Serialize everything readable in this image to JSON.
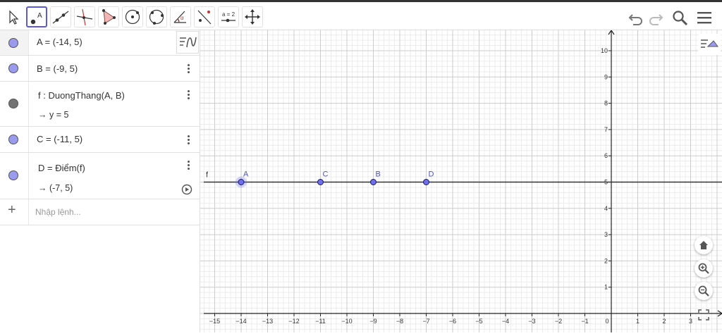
{
  "toolbar": {
    "tools": [
      {
        "name": "move-tool",
        "label": "Move"
      },
      {
        "name": "point-tool",
        "label": "A",
        "active": true
      },
      {
        "name": "line-tool",
        "label": "Line"
      },
      {
        "name": "perpendicular-line-tool",
        "label": "Perpendicular"
      },
      {
        "name": "polygon-tool",
        "label": "Polygon"
      },
      {
        "name": "circle-tool",
        "label": "Circle"
      },
      {
        "name": "circle-three-points-tool",
        "label": "Circle 3 points"
      },
      {
        "name": "angle-tool",
        "label": "Angle"
      },
      {
        "name": "reflect-tool",
        "label": "Reflect"
      },
      {
        "name": "slider-tool",
        "label": "a = 2"
      },
      {
        "name": "move-graphics-view-tool",
        "label": "Move view"
      }
    ],
    "slider_label": "a = 2",
    "point_label": "A",
    "angle_label": "α",
    "right_icons": [
      "undo-icon",
      "redo-icon",
      "search-icon",
      "menu-icon"
    ]
  },
  "algebra": {
    "rows": [
      {
        "text": "A = (-14, 5)",
        "color": "#9a9aee"
      },
      {
        "text": "B = (-9, 5)",
        "color": "#9a9aee"
      },
      {
        "text": "f : DuongThang(A, B)",
        "sub": "→  y = 5",
        "color": "#737373"
      },
      {
        "text": "C = (-11, 5)",
        "color": "#9a9aee"
      },
      {
        "text": "D  =  Điểm(f)",
        "sub": "→  (-7, 5)",
        "color": "#9a9aee"
      }
    ],
    "input_placeholder": "Nhập lệnh...",
    "plus": "+"
  },
  "graphics": {
    "x_ticks": [
      "−15",
      "−14",
      "−13",
      "−12",
      "−11",
      "−10",
      "−9",
      "−8",
      "−7",
      "−6",
      "−5",
      "−4",
      "−3",
      "−2",
      "−1",
      "0",
      "1",
      "2",
      "3"
    ],
    "y_ticks": [
      "1",
      "2",
      "3",
      "4",
      "5",
      "6",
      "7",
      "8",
      "9",
      "10"
    ],
    "line_label": "f",
    "line_y": 5,
    "points": [
      {
        "label": "A",
        "x": -14,
        "y": 5,
        "selected": true
      },
      {
        "label": "C",
        "x": -11,
        "y": 5
      },
      {
        "label": "B",
        "x": -9,
        "y": 5
      },
      {
        "label": "D",
        "x": -7,
        "y": 5
      }
    ],
    "buttons": [
      "home-icon",
      "zoom-in-icon",
      "zoom-out-icon",
      "fullscreen-icon"
    ],
    "colors": {
      "point_fill": "#6f6fee",
      "point_stroke": "#1a1a66",
      "axis": "#222222",
      "grid_major": "#cccccc",
      "grid_minor": "#ececec",
      "label": "#5050c8"
    }
  }
}
